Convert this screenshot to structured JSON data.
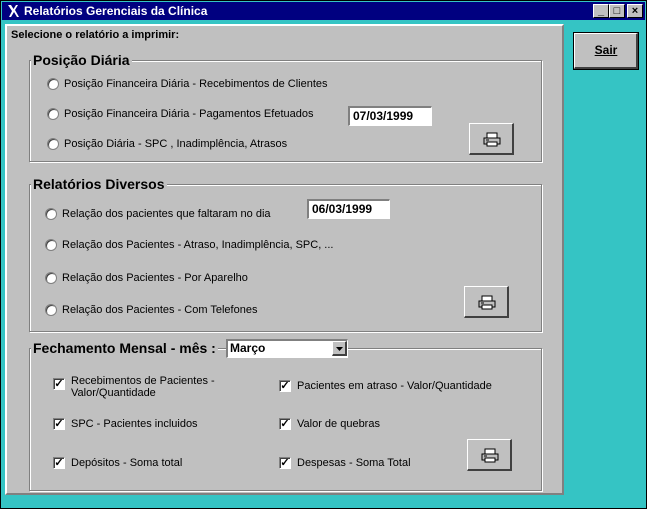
{
  "window": {
    "title": "Relatórios Gerenciais da Clínica",
    "controls": {
      "minimize": "_",
      "maximize": "□",
      "close": "×"
    }
  },
  "panel": {
    "prompt": "Selecione o relatório a imprimir:"
  },
  "posicao_diaria": {
    "legend": "Posição Diária",
    "options": [
      "Posição Financeira Diária - Recebimentos de Clientes",
      "Posição Financeira Diária - Pagamentos Efetuados",
      "Posição Diária - SPC , Inadimplência, Atrasos"
    ],
    "date": "07/03/1999"
  },
  "relatorios_diversos": {
    "legend": "Relatórios Diversos",
    "options": [
      "Relação dos pacientes que faltaram no dia",
      "Relação dos Pacientes - Atraso, Inadimplência, SPC, ...",
      "Relação dos Pacientes - Por Aparelho",
      "Relação dos Pacientes - Com Telefones"
    ],
    "date": "06/03/1999"
  },
  "fechamento": {
    "legend": "Fechamento Mensal - mês :",
    "month": "Março",
    "left_checks": [
      {
        "line1": "Recebimentos de Pacientes -",
        "line2": "Valor/Quantidade",
        "checked": true
      },
      {
        "line1": "SPC - Pacientes incluidos",
        "line2": "",
        "checked": true
      },
      {
        "line1": "Depósitos - Soma total",
        "line2": "",
        "checked": true
      }
    ],
    "right_checks": [
      {
        "label": "Pacientes em atraso - Valor/Quantidade",
        "checked": true
      },
      {
        "label": "Valor de quebras",
        "checked": true
      },
      {
        "label": "Despesas - Soma Total",
        "checked": true
      }
    ],
    "check_mark": "✓"
  },
  "buttons": {
    "sair": "Sair"
  },
  "icons": {
    "print": "printer-icon",
    "dropdown": "chevron-down-icon",
    "app": "app-icon"
  },
  "colors": {
    "titlebar": "#000080",
    "background": "#35c4c4",
    "face": "#c0c0c0"
  }
}
